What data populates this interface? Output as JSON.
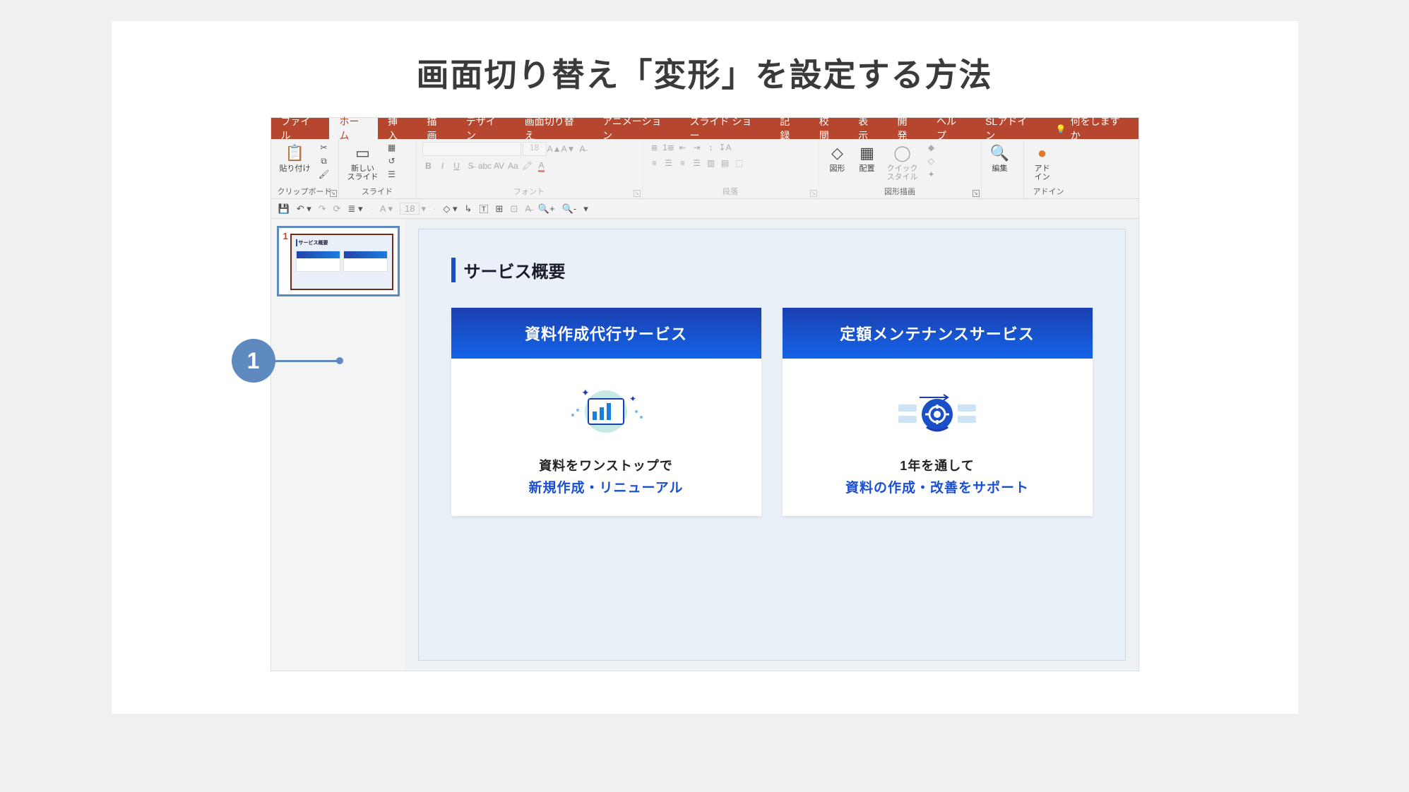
{
  "page_title": "画面切り替え「変形」を設定する方法",
  "callout_number": "1",
  "tabs": {
    "file": "ファイル",
    "home": "ホーム",
    "insert": "挿入",
    "draw": "描画",
    "design": "デザイン",
    "transitions": "画面切り替え",
    "animations": "アニメーション",
    "slideshow": "スライド ショー",
    "record": "記録",
    "review": "校閲",
    "view": "表示",
    "developer": "開発",
    "help": "ヘルプ",
    "addin": "SLアドイン",
    "tell": "何をしますか"
  },
  "ribbon": {
    "clipboard": {
      "label": "クリップボード",
      "paste": "貼り付け"
    },
    "slides": {
      "label": "スライド",
      "new": "新しい\nスライド"
    },
    "font": {
      "label": "フォント",
      "size": "18"
    },
    "paragraph": {
      "label": "段落"
    },
    "drawing": {
      "label": "図形描画",
      "shapes": "図形",
      "arrange": "配置",
      "quick": "クイック\nスタイル"
    },
    "editing": {
      "label": "編集"
    },
    "addins": {
      "label": "アドイン",
      "addin": "アド\nイン"
    }
  },
  "qat": {
    "size": "18"
  },
  "thumb": {
    "num": "1",
    "title": "サービス概要"
  },
  "slide": {
    "title": "サービス概要",
    "card1": {
      "head": "資料作成代行サービス",
      "t1": "資料をワンストップで",
      "t2": "新規作成・リニューアル"
    },
    "card2": {
      "head": "定額メンテナンスサービス",
      "t1": "1年を通して",
      "t2": "資料の作成・改善をサポート"
    }
  }
}
